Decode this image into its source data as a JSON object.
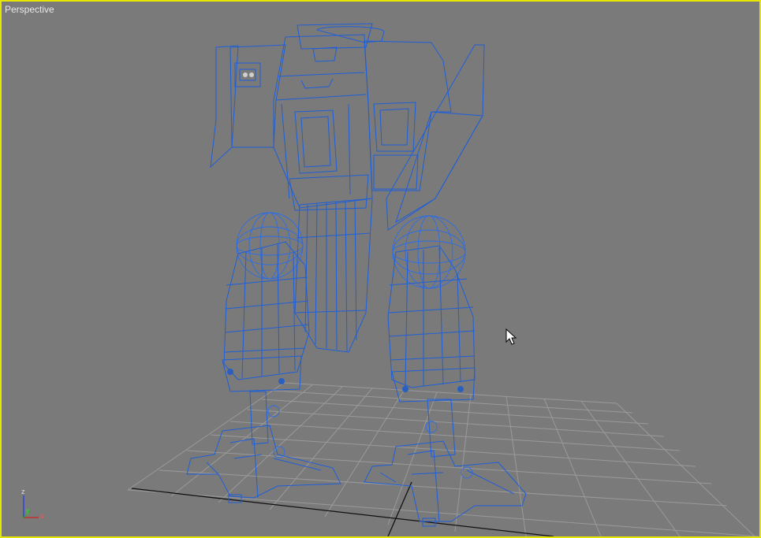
{
  "viewport": {
    "label": "Perspective",
    "border_color": "#e6e600",
    "background_color": "#7a7a7a",
    "wire_color": "#1f5fd8"
  },
  "axis_gizmo": {
    "z_label": "z",
    "y_label": "y",
    "x_label": "x",
    "x_color": "#d02020",
    "y_color": "#20b020",
    "z_color": "#2040e0"
  },
  "scene": {
    "object": "mech-robot",
    "cursor": "arrow-cursor-icon"
  }
}
